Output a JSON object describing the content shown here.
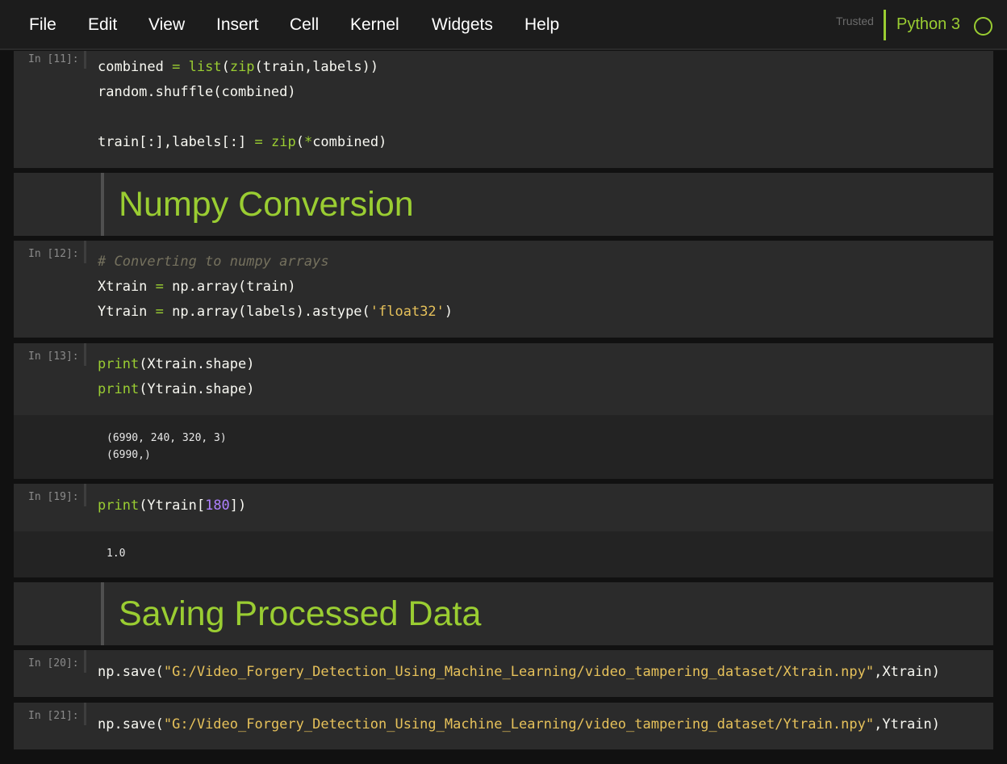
{
  "menubar": {
    "items": [
      "File",
      "Edit",
      "View",
      "Insert",
      "Cell",
      "Kernel",
      "Widgets",
      "Help"
    ],
    "trusted_label": "Trusted",
    "kernel_name": "Python 3"
  },
  "cells": {
    "c11": {
      "prompt": "In [11]:",
      "lines": [
        [
          [
            "combined ",
            "plain"
          ],
          [
            "=",
            "op"
          ],
          [
            " ",
            "plain"
          ],
          [
            "list",
            "kw"
          ],
          [
            "(",
            "plain"
          ],
          [
            "zip",
            "kw"
          ],
          [
            "(train,labels))",
            "plain"
          ]
        ],
        [
          [
            "random.shuffle(combined)",
            "plain"
          ]
        ],
        [
          [
            "",
            "plain"
          ]
        ],
        [
          [
            "train[:],labels[:] ",
            "plain"
          ],
          [
            "=",
            "op"
          ],
          [
            " ",
            "plain"
          ],
          [
            "zip",
            "kw"
          ],
          [
            "(",
            "plain"
          ],
          [
            "*",
            "op"
          ],
          [
            "combined)",
            "plain"
          ]
        ]
      ]
    },
    "md1": {
      "heading": "Numpy Conversion"
    },
    "c12": {
      "prompt": "In [12]:",
      "lines": [
        [
          [
            "# Converting to numpy arrays",
            "cmt"
          ]
        ],
        [
          [
            "Xtrain ",
            "plain"
          ],
          [
            "=",
            "op"
          ],
          [
            " np.array(train)",
            "plain"
          ]
        ],
        [
          [
            "Ytrain ",
            "plain"
          ],
          [
            "=",
            "op"
          ],
          [
            " np.array(labels).astype(",
            "plain"
          ],
          [
            "'float32'",
            "str"
          ],
          [
            ")",
            "plain"
          ]
        ]
      ]
    },
    "c13": {
      "prompt": "In [13]:",
      "lines": [
        [
          [
            "print",
            "kw"
          ],
          [
            "(Xtrain.shape)",
            "plain"
          ]
        ],
        [
          [
            "print",
            "kw"
          ],
          [
            "(Ytrain.shape)",
            "plain"
          ]
        ]
      ],
      "output": [
        "(6990, 240, 320, 3)",
        "(6990,)"
      ]
    },
    "c19": {
      "prompt": "In [19]:",
      "lines": [
        [
          [
            "print",
            "kw"
          ],
          [
            "(Ytrain[",
            "plain"
          ],
          [
            "180",
            "num"
          ],
          [
            "])",
            "plain"
          ]
        ]
      ],
      "output": [
        "1.0"
      ]
    },
    "md2": {
      "heading": "Saving Processed Data"
    },
    "c20": {
      "prompt": "In [20]:",
      "lines": [
        [
          [
            "np.save(",
            "plain"
          ],
          [
            "\"G:/Video_Forgery_Detection_Using_Machine_Learning/video_tampering_dataset/Xtrain.npy\"",
            "str"
          ],
          [
            ",Xtrain)",
            "plain"
          ]
        ]
      ]
    },
    "c21": {
      "prompt": "In [21]:",
      "lines": [
        [
          [
            "np.save(",
            "plain"
          ],
          [
            "\"G:/Video_Forgery_Detection_Using_Machine_Learning/video_tampering_dataset/Ytrain.npy\"",
            "str"
          ],
          [
            ",Ytrain)",
            "plain"
          ]
        ]
      ]
    }
  }
}
